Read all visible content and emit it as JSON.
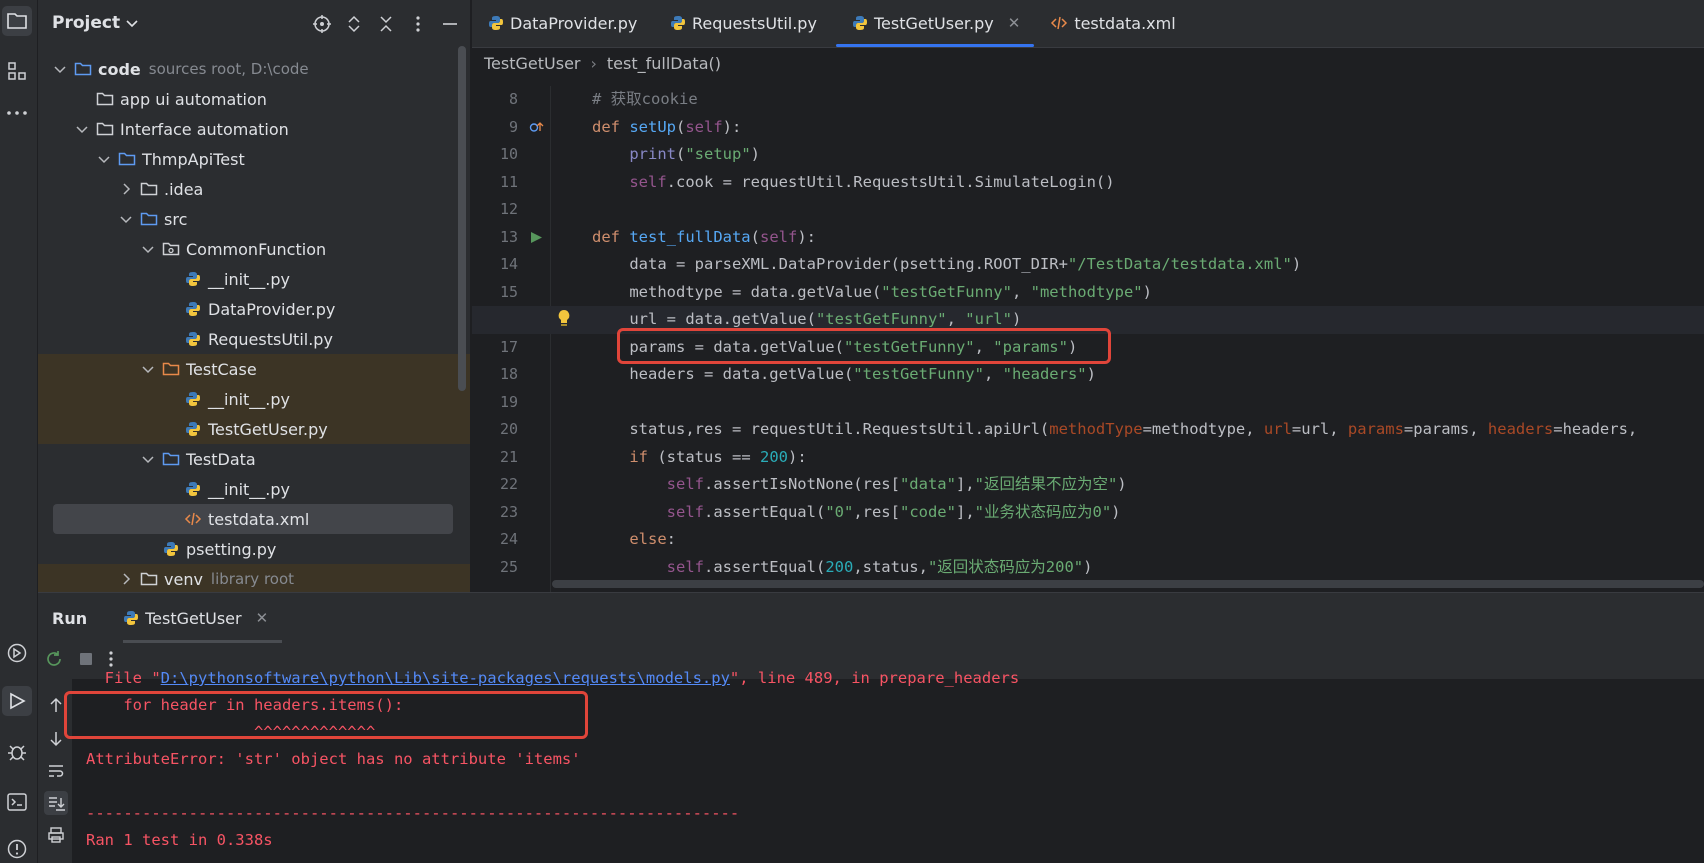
{
  "project": {
    "title": "Project",
    "tree": [
      {
        "label": "code",
        "hint": "sources root,  D:\\code",
        "indent": 0,
        "arrow": "down",
        "icon": "folder",
        "bold": true
      },
      {
        "label": "app ui automation",
        "hint": "",
        "indent": 1,
        "arrow": "",
        "icon": "folder-plain"
      },
      {
        "label": "Interface automation",
        "hint": "",
        "indent": 1,
        "arrow": "down",
        "icon": "folder-plain"
      },
      {
        "label": "ThmpApiTest",
        "hint": "",
        "indent": 2,
        "arrow": "down",
        "icon": "folder"
      },
      {
        "label": ".idea",
        "hint": "",
        "indent": 3,
        "arrow": "right",
        "icon": "folder-plain"
      },
      {
        "label": "src",
        "hint": "",
        "indent": 3,
        "arrow": "down",
        "icon": "folder"
      },
      {
        "label": "CommonFunction",
        "hint": "",
        "indent": 4,
        "arrow": "down",
        "icon": "package"
      },
      {
        "label": "__init__.py",
        "hint": "",
        "indent": 5,
        "arrow": "",
        "icon": "python"
      },
      {
        "label": "DataProvider.py",
        "hint": "",
        "indent": 5,
        "arrow": "",
        "icon": "python"
      },
      {
        "label": "RequestsUtil.py",
        "hint": "",
        "indent": 5,
        "arrow": "",
        "icon": "python"
      },
      {
        "label": "TestCase",
        "hint": "",
        "indent": 4,
        "arrow": "down",
        "icon": "folder-orange",
        "hl": true
      },
      {
        "label": "__init__.py",
        "hint": "",
        "indent": 5,
        "arrow": "",
        "icon": "python",
        "hl": true
      },
      {
        "label": "TestGetUser.py",
        "hint": "",
        "indent": 5,
        "arrow": "",
        "icon": "python",
        "hl": true
      },
      {
        "label": "TestData",
        "hint": "",
        "indent": 4,
        "arrow": "down",
        "icon": "folder"
      },
      {
        "label": "__init__.py",
        "hint": "",
        "indent": 5,
        "arrow": "",
        "icon": "python"
      },
      {
        "label": "testdata.xml",
        "hint": "",
        "indent": 5,
        "arrow": "",
        "icon": "xml",
        "sel": true
      },
      {
        "label": "psetting.py",
        "hint": "",
        "indent": 4,
        "arrow": "",
        "icon": "python"
      },
      {
        "label": "venv",
        "hint": "library root",
        "indent": 3,
        "arrow": "right",
        "icon": "folder-plain",
        "hl": true
      }
    ]
  },
  "editor": {
    "tabs": [
      {
        "label": "DataProvider.py",
        "icon": "python"
      },
      {
        "label": "RequestsUtil.py",
        "icon": "python"
      },
      {
        "label": "TestGetUser.py",
        "icon": "python",
        "active": true
      },
      {
        "label": "testdata.xml",
        "icon": "xml"
      }
    ],
    "breadcrumb": [
      "TestGetUser",
      "test_fullData()"
    ],
    "line_numbers": [
      "8",
      "9",
      "10",
      "11",
      "12",
      "13",
      "14",
      "15",
      "16",
      "17",
      "18",
      "19",
      "20",
      "21",
      "22",
      "23",
      "24",
      "25"
    ]
  },
  "run": {
    "title": "Run",
    "tab": "TestGetUser",
    "console": {
      "line1_pre": "  File \"",
      "line1_link": "D:\\pythonsoftware\\python\\Lib\\site-packages\\requests\\models.py",
      "line1_post": "\", line 489, in prepare_headers",
      "line2": "    for header in headers.items():",
      "line3": "                  ^^^^^^^^^^^^^",
      "line4": "AttributeError: 'str' object has no attribute 'items'",
      "line5": "",
      "line6": "----------------------------------------------------------------------",
      "line7": "Ran 1 test in 0.338s"
    }
  },
  "colors": {
    "accent": "#3574f0",
    "highlight_box": "#e0453a",
    "error_text": "#f75464"
  }
}
